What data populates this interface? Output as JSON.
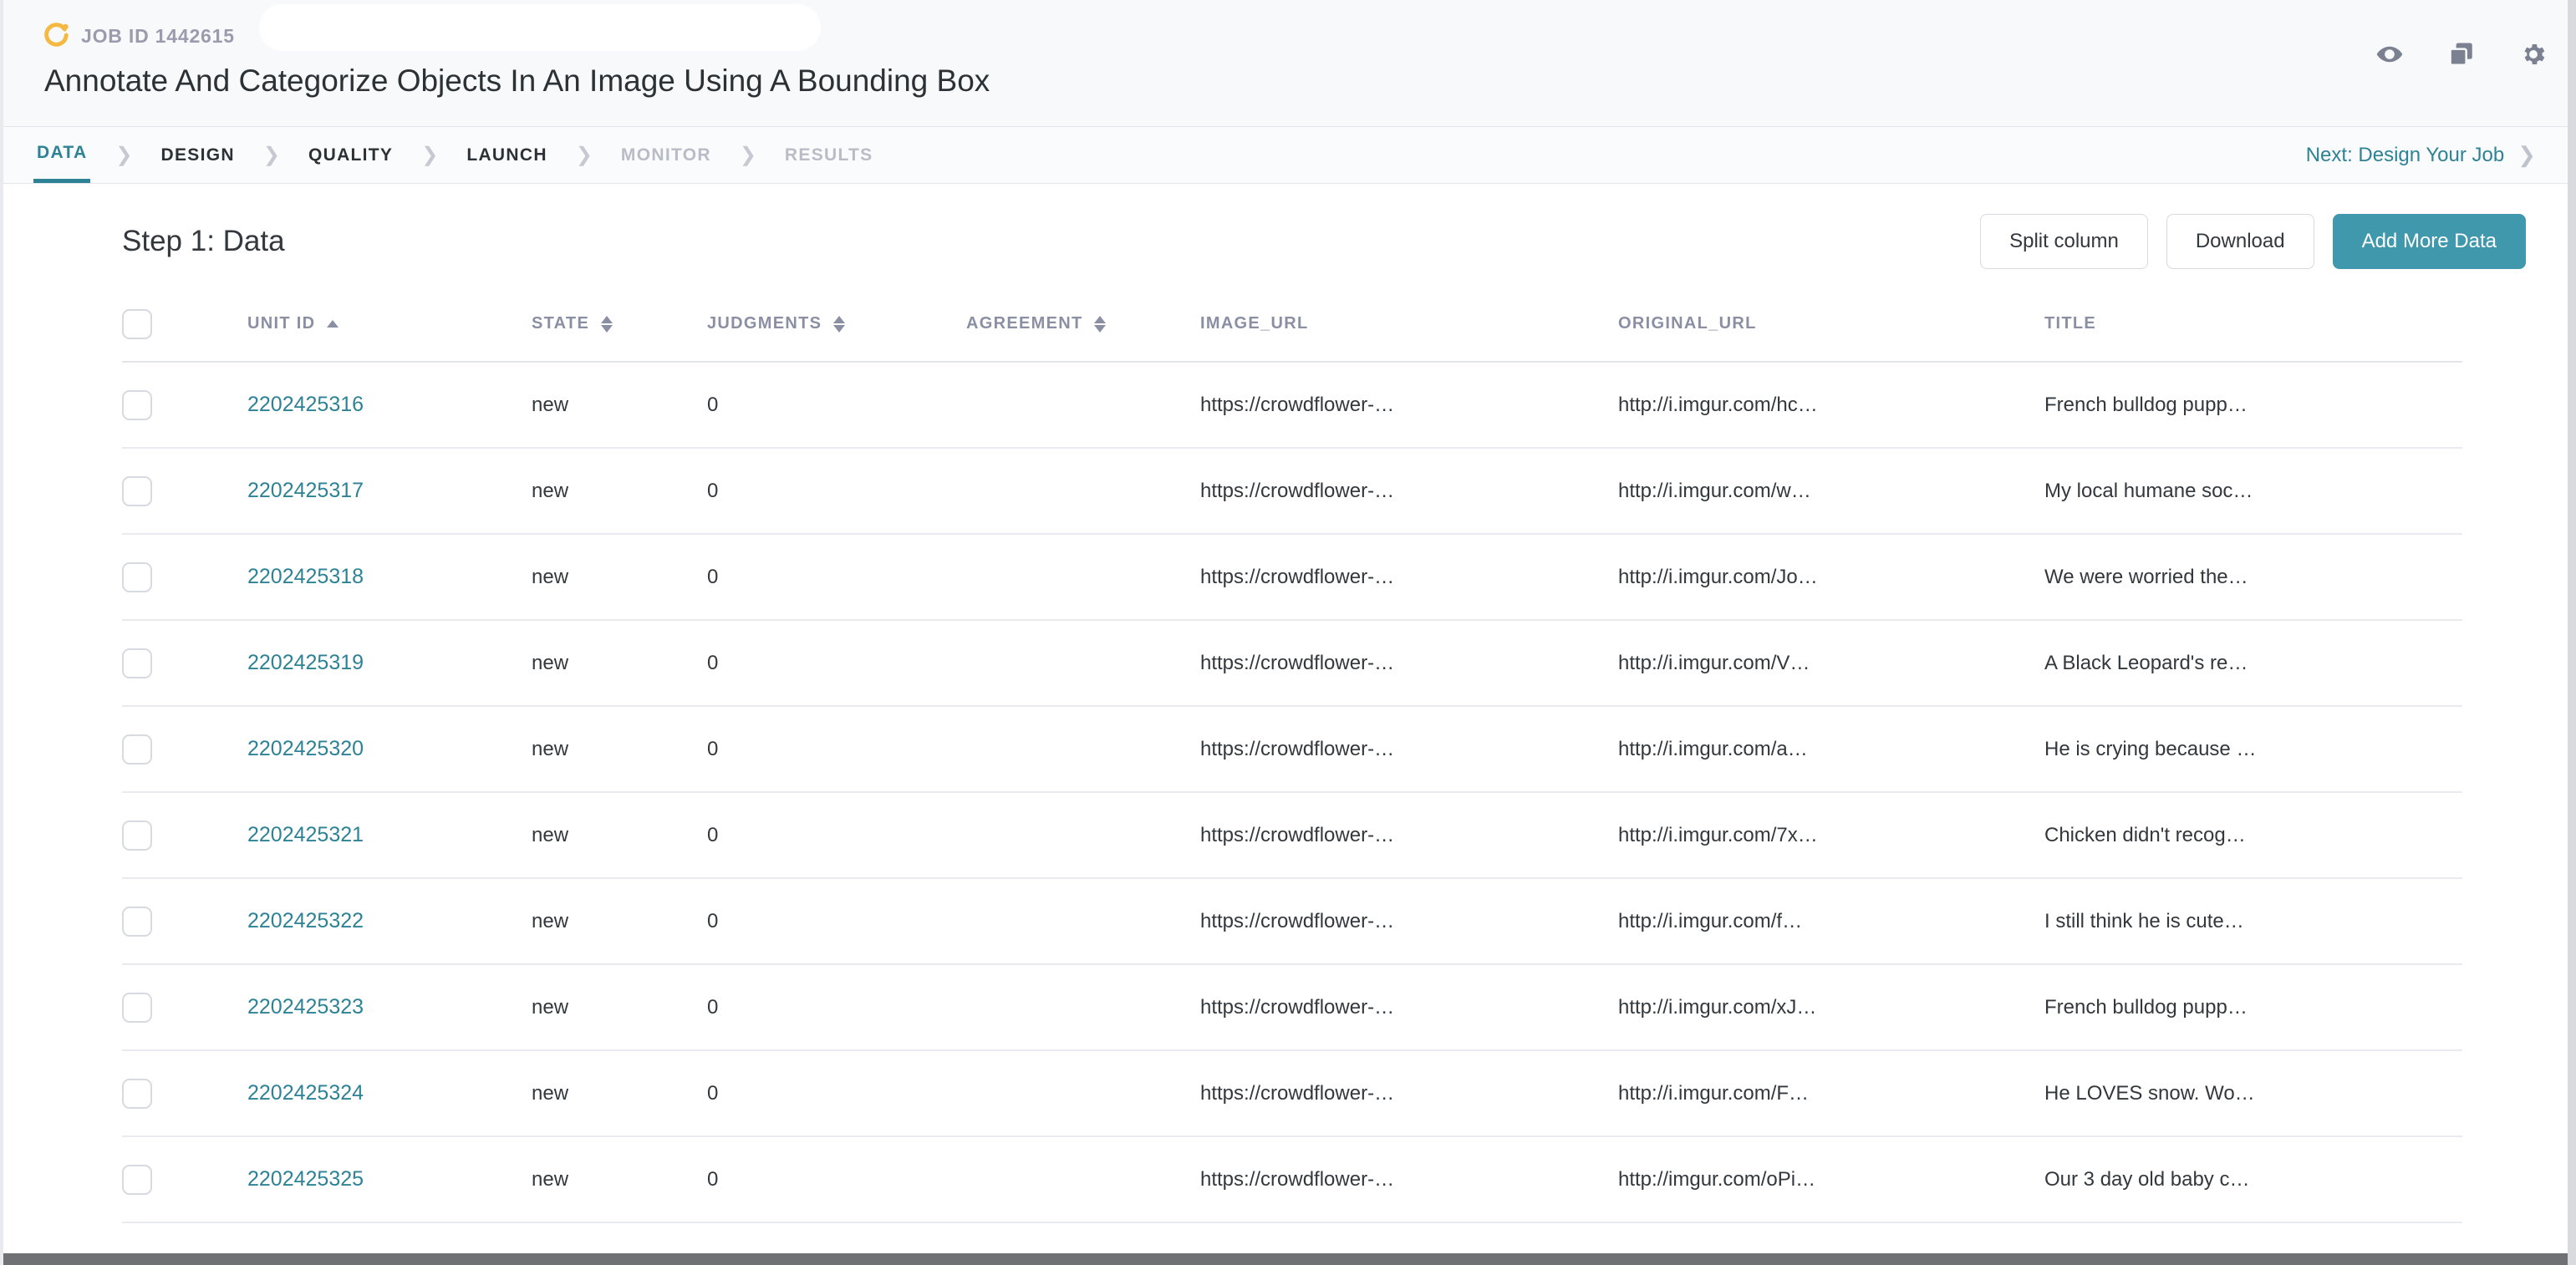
{
  "colors": {
    "accent_teal": "#2d8295",
    "primary_button": "#4098ac",
    "logo_orange": "#f5b841",
    "header_bg": "#f8f9fa",
    "muted_text": "#8a8fa3",
    "disabled_text": "#b9bcc7"
  },
  "header": {
    "job_id_label": "JOB ID 1442615",
    "logo_icon": "crowdflower-circle-icon",
    "job_title": "Annotate And Categorize Objects In An Image Using A Bounding Box",
    "icons": [
      {
        "name": "eye-icon",
        "label": "Preview"
      },
      {
        "name": "copy-icon",
        "label": "Copy Job"
      },
      {
        "name": "gear-icon",
        "label": "Settings"
      }
    ]
  },
  "nav": {
    "steps": [
      {
        "label": "DATA",
        "state": "active"
      },
      {
        "label": "DESIGN",
        "state": "enabled"
      },
      {
        "label": "QUALITY",
        "state": "enabled"
      },
      {
        "label": "LAUNCH",
        "state": "enabled"
      },
      {
        "label": "MONITOR",
        "state": "disabled"
      },
      {
        "label": "RESULTS",
        "state": "disabled"
      }
    ],
    "chevron": "❯",
    "next_label": "Next: Design Your Job",
    "next_chevron": "❯"
  },
  "main": {
    "step_title": "Step 1: Data",
    "buttons": {
      "split_column": "Split column",
      "download": "Download",
      "add_more_data": "Add More Data"
    }
  },
  "table": {
    "select_all_checkbox": "unchecked",
    "columns": [
      {
        "key": "unit_id",
        "label": "UNIT ID",
        "sort": "asc",
        "align": "left"
      },
      {
        "key": "state",
        "label": "STATE",
        "sort": "both",
        "align": "left"
      },
      {
        "key": "judgments",
        "label": "JUDGMENTS",
        "sort": "both",
        "align": "left"
      },
      {
        "key": "agreement",
        "label": "AGREEMENT",
        "sort": "both",
        "align": "left"
      },
      {
        "key": "image_url",
        "label": "IMAGE_URL",
        "sort": "none",
        "align": "left"
      },
      {
        "key": "original_url",
        "label": "ORIGINAL_URL",
        "sort": "none",
        "align": "left"
      },
      {
        "key": "title",
        "label": "TITLE",
        "sort": "none",
        "align": "left"
      }
    ],
    "rows": [
      {
        "checked": false,
        "unit_id": "2202425316",
        "state": "new",
        "judgments": "0",
        "agreement": "",
        "image_url": "https://crowdflower-…",
        "original_url": "http://i.imgur.com/hc…",
        "title": "French bulldog pupp…"
      },
      {
        "checked": false,
        "unit_id": "2202425317",
        "state": "new",
        "judgments": "0",
        "agreement": "",
        "image_url": "https://crowdflower-…",
        "original_url": "http://i.imgur.com/w…",
        "title": "My local humane soc…"
      },
      {
        "checked": false,
        "unit_id": "2202425318",
        "state": "new",
        "judgments": "0",
        "agreement": "",
        "image_url": "https://crowdflower-…",
        "original_url": "http://i.imgur.com/Jo…",
        "title": "We were worried the…"
      },
      {
        "checked": false,
        "unit_id": "2202425319",
        "state": "new",
        "judgments": "0",
        "agreement": "",
        "image_url": "https://crowdflower-…",
        "original_url": "http://i.imgur.com/V…",
        "title": "A Black Leopard's re…"
      },
      {
        "checked": false,
        "unit_id": "2202425320",
        "state": "new",
        "judgments": "0",
        "agreement": "",
        "image_url": "https://crowdflower-…",
        "original_url": "http://i.imgur.com/a…",
        "title": "He is crying because …"
      },
      {
        "checked": false,
        "unit_id": "2202425321",
        "state": "new",
        "judgments": "0",
        "agreement": "",
        "image_url": "https://crowdflower-…",
        "original_url": "http://i.imgur.com/7x…",
        "title": "Chicken didn't recog…"
      },
      {
        "checked": false,
        "unit_id": "2202425322",
        "state": "new",
        "judgments": "0",
        "agreement": "",
        "image_url": "https://crowdflower-…",
        "original_url": "http://i.imgur.com/f…",
        "title": "I still think he is cute…"
      },
      {
        "checked": false,
        "unit_id": "2202425323",
        "state": "new",
        "judgments": "0",
        "agreement": "",
        "image_url": "https://crowdflower-…",
        "original_url": "http://i.imgur.com/xJ…",
        "title": "French bulldog pupp…"
      },
      {
        "checked": false,
        "unit_id": "2202425324",
        "state": "new",
        "judgments": "0",
        "agreement": "",
        "image_url": "https://crowdflower-…",
        "original_url": "http://i.imgur.com/F…",
        "title": "He LOVES snow. Wo…"
      },
      {
        "checked": false,
        "unit_id": "2202425325",
        "state": "new",
        "judgments": "0",
        "agreement": "",
        "image_url": "https://crowdflower-…",
        "original_url": "http://imgur.com/oPi…",
        "title": "Our 3 day old baby c…"
      }
    ]
  }
}
